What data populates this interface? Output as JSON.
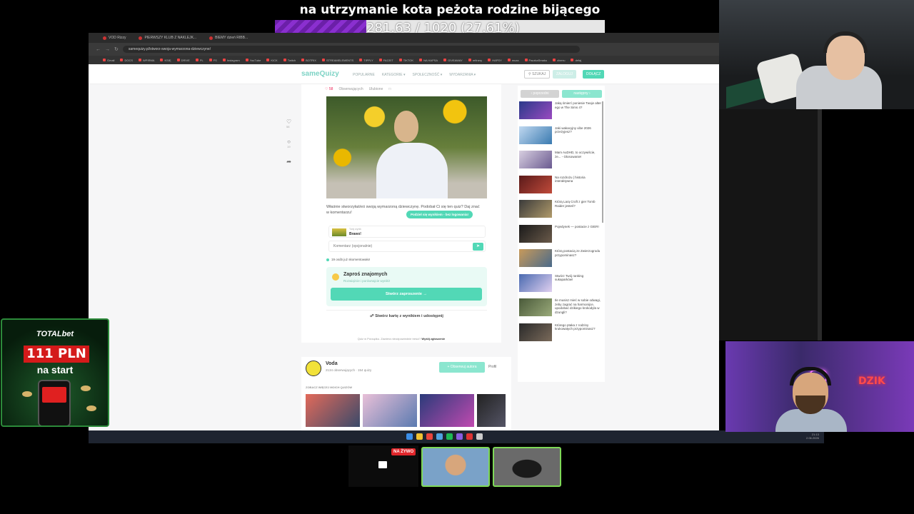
{
  "overlay": {
    "goal_title": "na utrzymanie kota peżota rodzine bijącego",
    "goal_text": "281.63 / 1020 (27.61%)",
    "goal_progress": 0.2761
  },
  "browser": {
    "tabs": [
      {
        "label": "VOD Rizzy"
      },
      {
        "label": "PIERWSZY KLUB Z NAKLEJK..."
      },
      {
        "label": "BIEMY dzień RIBB..."
      }
    ],
    "url": "samequizy.pl/stworz-swoja-wymarzona-dziewczyne/",
    "bookmarks": [
      "Gmail",
      "DOCS",
      "WPIRMA",
      "KSIĘ",
      "DRIVE",
      "PL",
      "FS",
      "Instagram",
      "YouTube",
      "KICK",
      "Twitch",
      "BOTRIX",
      "STREAMELEMENTS",
      "TIPPLY",
      "FACEIT",
      "TIKTOK",
      "NA HAPSA",
      "GIVEAWAY",
      "refinery",
      "HAPSY",
      "muza",
      "PaczkaSmaku",
      "cherru",
      "defaj"
    ]
  },
  "site": {
    "logo": "sameQuizy",
    "nav": [
      "POPULARNE",
      "KATEGORIE ▾",
      "SPOŁECZNOŚĆ ▾",
      "WYDARZANIA ▾"
    ],
    "search_btn": "SZUKAJ",
    "login_btn": "ZALOGUJ",
    "join_btn": "DOŁĄCZ",
    "meta": {
      "likes": "58",
      "watchers": "Obserwujących",
      "save": "Ulubione"
    },
    "description": "Właśnie stworzyłaś/eś swoją wymarzoną dziewczynę. Podobał Ci się ten quiz? Daj znać w komentarzu!",
    "share_pill": "Podziel się wynikiem - bez logowania!",
    "result_small": "Twój wynik",
    "result_big": "Brawo!",
    "comment_placeholder": "Komentarz (opcjonalnie)",
    "people_count": "19 osób już skomentowało!",
    "invite_title": "Zaproś znajomych",
    "invite_sub": "Rozwiążcie i porównajcie wyniki!",
    "invite_btn": "Stwórz zaproszenie →",
    "card_link": "Stwórz kartę z wynikiem i udostępnij",
    "footnote_prefix": "Quiz w Porządku. Zawiera nieodpowiednie treści?",
    "footnote_link": "Wyślij zgłoszenie",
    "side_actions": {
      "likes": "58",
      "comments": "19"
    },
    "sidebar": {
      "prev": "‹ poprzedni",
      "next": "następny ›",
      "items": [
        "Jaką śmierć poniesie Twoje alter ego w The Sims 4?",
        "Jaki wakacyjny vibe 2026 przeżyjesz?",
        "Mam AuDHD, to oczywiście, że... - Głosowanie!",
        "Na rozdrożu | historia interaktywna",
        "Którą Larą Croft z gier Tomb Raider jesteś?",
        "Pojedynek — postacie z GIER!",
        "Którą postacią ze Zwierzogrodu przypominasz?",
        "Stwórz Twój ranking sukaparków!",
        "Ile musisz mieć w sobie odwagi, żeby zagrać na harmonijce, upodobać dzikiego krokodyla w dzungli?",
        "Którego ptaka z rodziny krukowatych przypominasz?"
      ]
    },
    "author": {
      "name": "Voda",
      "stats": "2134 obserwujących · 154 quizy",
      "follow_btn": "+ Obserwuj autora",
      "profile_btn": "Profil",
      "more_label": "ZOBACZ WIĘCEJ MOICH QUIZÓW"
    }
  },
  "taskbar": {
    "time": "21:13",
    "date": "2.06.2026"
  },
  "ad": {
    "brand": "TOTALbet",
    "amount": "111 PLN",
    "sub": "na start"
  },
  "cam_bottom": {
    "logo": "DZIK"
  },
  "stage": {
    "live_badge": "NA ŻYWO"
  },
  "colors": {
    "accent": "#52d8b6",
    "goal_fill": "#7a2abf",
    "ad_red": "#d41a1a"
  }
}
